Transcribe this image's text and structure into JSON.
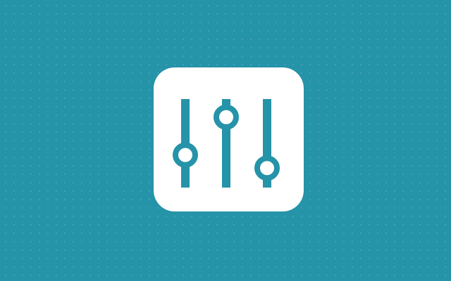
{
  "app_icon": {
    "name": "equalizer-settings",
    "background_color": "#2593a8",
    "tile_color": "#ffffff",
    "glyph_color": "#2593a8",
    "sliders": [
      {
        "label": "",
        "level": 0.33
      },
      {
        "label": "",
        "level": 0.88
      },
      {
        "label": "",
        "level": 0.14
      }
    ]
  }
}
